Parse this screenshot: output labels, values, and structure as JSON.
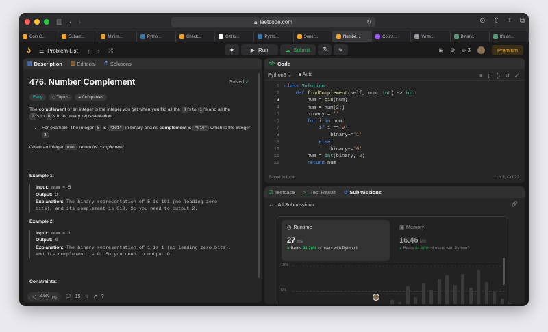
{
  "browser": {
    "url": "leetcode.com",
    "tabs": [
      {
        "label": "Coin C...",
        "icon_color": "#f0a42a",
        "icon": "leetcode-icon"
      },
      {
        "label": "Subarr...",
        "icon_color": "#f0a42a",
        "icon": "leetcode-icon"
      },
      {
        "label": "Minim...",
        "icon_color": "#f0a42a",
        "icon": "leetcode-icon"
      },
      {
        "label": "Pytho...",
        "icon_color": "#3776ab",
        "icon": "python-icon"
      },
      {
        "label": "Check...",
        "icon_color": "#f0a42a",
        "icon": "leetcode-icon"
      },
      {
        "label": "GitHu...",
        "icon_color": "#ffffff",
        "icon": "github-icon"
      },
      {
        "label": "Pytho...",
        "icon_color": "#3776ab",
        "icon": "python-icon"
      },
      {
        "label": "Super...",
        "icon_color": "#f0a42a",
        "icon": "leetcode-icon"
      },
      {
        "label": "Numbe...",
        "icon_color": "#f0a42a",
        "icon": "leetcode-icon",
        "active": true
      },
      {
        "label": "Cours...",
        "icon_color": "#9b59f0",
        "icon": "course-icon"
      },
      {
        "label": "Write...",
        "icon_color": "#999999",
        "icon": "write-icon"
      },
      {
        "label": "Binary...",
        "icon_color": "#5a9a7a",
        "icon": "binary-icon"
      },
      {
        "label": "It's an...",
        "icon_color": "#5a9a7a",
        "icon": "doc-icon"
      }
    ]
  },
  "nav": {
    "problem_list": "Problem List",
    "run": "Run",
    "submit": "Submit",
    "streak": "3",
    "premium": "Premium"
  },
  "description": {
    "tabs": [
      "Description",
      "Editorial",
      "Solutions"
    ],
    "title": "476. Number Complement",
    "solved": "Solved",
    "tags": [
      "Easy",
      "Topics",
      "Companies"
    ],
    "p1": {
      "a": "The ",
      "b": "complement",
      "c": " of an integer is the integer you get when you flip all the ",
      "d": "0",
      "e": "'s to ",
      "f": "1",
      "g": "'s and all the",
      "h": "1",
      "i": "'s to ",
      "j": "0",
      "k": "'s in its binary representation."
    },
    "bullet": {
      "a": "For example, The integer ",
      "b": "5",
      "c": " is ",
      "d": "\"101\"",
      "e": " in binary and its ",
      "f": "complement",
      "g": " is ",
      "h": "\"010\"",
      "i": " which is the integer ",
      "j": "2",
      "k": "."
    },
    "p2": {
      "a": "Given an integer ",
      "b": "num",
      "c": ", return ",
      "d": "its complement",
      "e": "."
    },
    "example1": {
      "title": "Example 1:",
      "input_label": "Input:",
      "input": " num = 5",
      "output_label": "Output:",
      "output": " 2",
      "expl_label": "Explanation:",
      "expl1": " The binary representation of 5 is 101 (no leading zero",
      "expl2": "bits), and its complement is 010. So you need to output 2."
    },
    "example2": {
      "title": "Example 2:",
      "input_label": "Input:",
      "input": " num = 1",
      "output_label": "Output:",
      "output": " 0",
      "expl_label": "Explanation:",
      "expl1": " The binary representation of 1 is 1 (no leading zero bits),",
      "expl2": "and its complement is 0. So you need to output 0."
    },
    "constraints": "Constraints:",
    "likes": "2.6K",
    "comments": "15"
  },
  "editor": {
    "header": "Code",
    "language": "Python3",
    "autosave": "Auto",
    "saved": "Saved to local",
    "cursor": "Ln 3, Col 23",
    "line_numbers": [
      "1",
      "2",
      "3",
      "4",
      "5",
      "6",
      "7",
      "8",
      "9",
      "10",
      "11",
      "12"
    ]
  },
  "results": {
    "tabs": [
      "Testcase",
      "Test Result",
      "Submissions"
    ],
    "back": "All Submissions",
    "runtime": {
      "label": "Runtime",
      "value": "27",
      "unit": "ms",
      "beats": "Beats",
      "pct": "94.26%",
      "suffix": "of users with Python3"
    },
    "memory": {
      "label": "Memory",
      "value": "16.46",
      "unit": "MB",
      "beats": "Beats",
      "pct": "84.60%",
      "suffix": "of users with Python3"
    },
    "yticks": [
      "10%",
      "5%"
    ]
  },
  "colors": {
    "accent_green": "#2cbb5d",
    "leetcode_orange": "#f0a42a",
    "easy": "#1cbaba"
  }
}
